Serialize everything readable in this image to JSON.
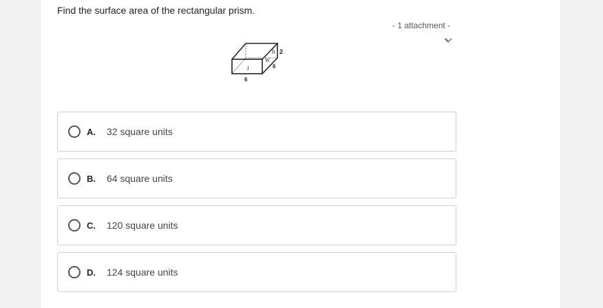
{
  "question": {
    "text": "Find the surface area of the rectangular prism."
  },
  "attachment": {
    "label": "- 1 attachment  -",
    "toggle_icon": "chevron-down-icon"
  },
  "figure": {
    "labels": {
      "h": "h",
      "height_value": "2",
      "w": "W",
      "width_value": "6",
      "l": "l",
      "length_value": "6"
    }
  },
  "options": [
    {
      "letter": "A.",
      "text": "32 square units"
    },
    {
      "letter": "B.",
      "text": "64 square units"
    },
    {
      "letter": "C.",
      "text": "120 square units"
    },
    {
      "letter": "D.",
      "text": "124 square units"
    }
  ]
}
